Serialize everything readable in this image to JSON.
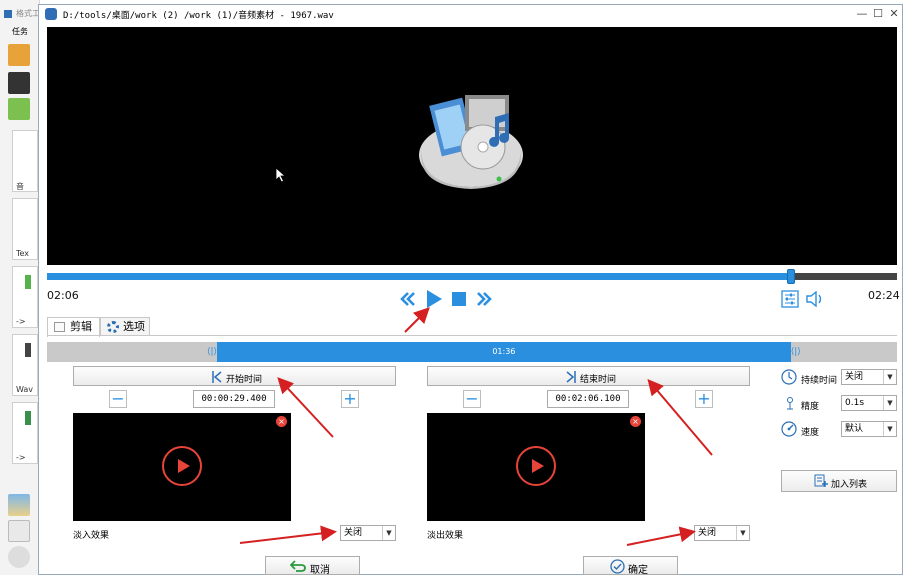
{
  "background_app": {
    "title_fragment": "格式工",
    "menu_task": "任务",
    "tile_labels": [
      "音",
      "Tex",
      "->",
      "Wav",
      "->"
    ]
  },
  "window": {
    "title": "D:/tools/桌面/work (2) /work (1)/音频素材 - 1967.wav",
    "minimize": "—",
    "maximize": "☐",
    "close": "✕"
  },
  "player": {
    "current_time": "02:06",
    "total_time": "02:24",
    "progress": 0.875
  },
  "tabs": [
    {
      "label": "剪辑",
      "active": true
    },
    {
      "label": "选项",
      "active": false
    }
  ],
  "range_bar": {
    "start_fraction": 0.2,
    "end_fraction": 0.875,
    "duration_label": "01:36"
  },
  "start_panel": {
    "button_label": "开始时间",
    "time_value": "00:00:29.400",
    "minus": "−",
    "plus": "+",
    "effect_label": "淡入效果",
    "effect_value": "关闭"
  },
  "end_panel": {
    "button_label": "结束时间",
    "time_value": "00:02:06.100",
    "minus": "−",
    "plus": "+",
    "effect_label": "淡出效果",
    "effect_value": "关闭"
  },
  "right_panel": {
    "duration_label": "持续时间",
    "duration_value": "关闭",
    "precision_label": "精度",
    "precision_value": "0.1s",
    "speed_label": "速度",
    "speed_value": "默认",
    "add_list_label": "加入列表"
  },
  "footer": {
    "cancel_label": "取消",
    "ok_label": "确定"
  },
  "colors": {
    "accent": "#2b8fe0",
    "annotation_red": "#d42020"
  }
}
